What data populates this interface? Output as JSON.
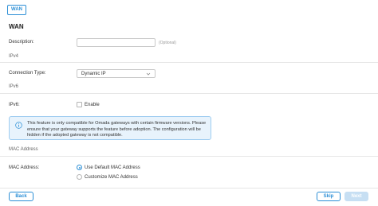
{
  "header": {
    "tag": "WAN",
    "title": "WAN"
  },
  "description": {
    "label": "Description:",
    "value": "",
    "hint": "(Optional)"
  },
  "ipv4": {
    "heading": "IPv4",
    "connection_type_label": "Connection Type:",
    "connection_type_value": "Dynamic IP"
  },
  "ipv6": {
    "heading": "IPv6",
    "label": "IPv6:",
    "enable_label": "Enable",
    "enabled": false
  },
  "notice": {
    "text": "This feature is only compatible for Omada gateways with certain firmware versions. Please ensure that your gateway supports the feature before adoption. The configuration will be hidden if the adopted gateway is not compatible."
  },
  "mac": {
    "heading": "MAC Address",
    "label": "MAC Address:",
    "options": [
      "Use Default MAC Address",
      "Customize MAC Address"
    ],
    "selected_index": 0
  },
  "footer": {
    "back": "Back",
    "skip": "Skip",
    "next": "Next"
  },
  "colors": {
    "accent": "#2c8fd6",
    "notice_bg": "#e8f3fc",
    "next_disabled": "#c7dff3"
  }
}
